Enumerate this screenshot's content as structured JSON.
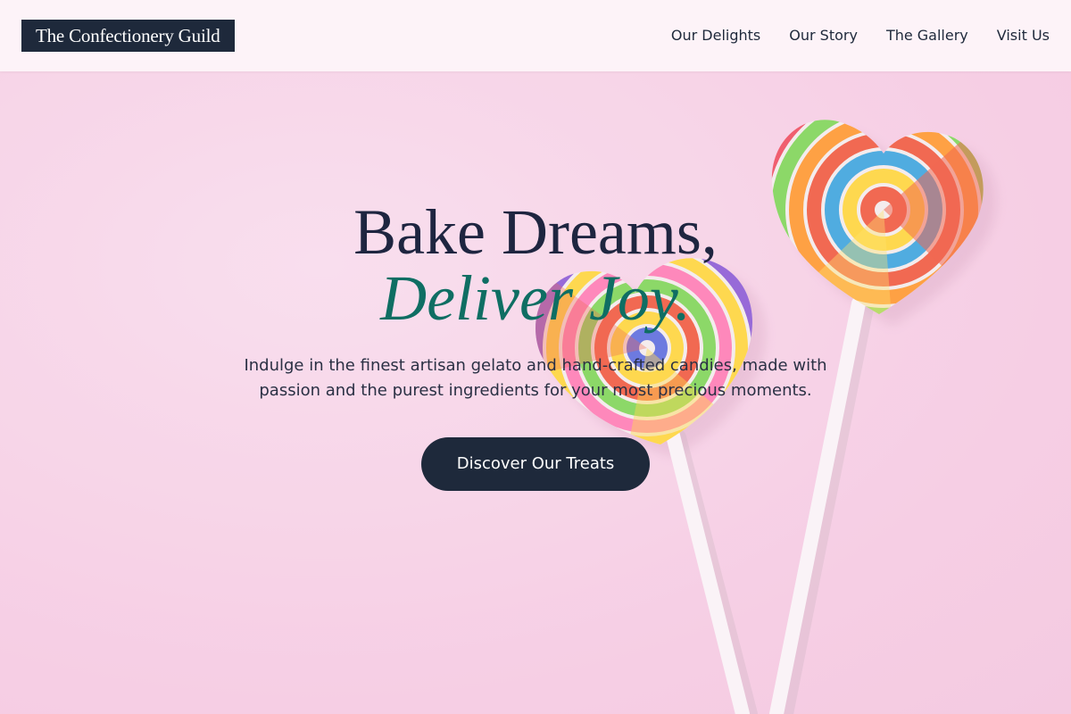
{
  "header": {
    "logo": "The Confectionery Guild",
    "nav": [
      {
        "label": "Our Delights"
      },
      {
        "label": "Our Story"
      },
      {
        "label": "The Gallery"
      },
      {
        "label": "Visit Us"
      }
    ]
  },
  "hero": {
    "title_line1": "Bake Dreams,",
    "title_line2": "Deliver Joy.",
    "subtitle": "Indulge in the finest artisan gelato and hand-crafted candies, made with passion and the purest ingredients for your most precious moments.",
    "cta_label": "Discover Our Treats",
    "background_image": "heart-lollipops-image"
  },
  "colors": {
    "header_bg": "#fdf3f8",
    "hero_bg": "#f7d2e6",
    "navy": "#1e293b",
    "teal_accent": "#0f6e63"
  }
}
